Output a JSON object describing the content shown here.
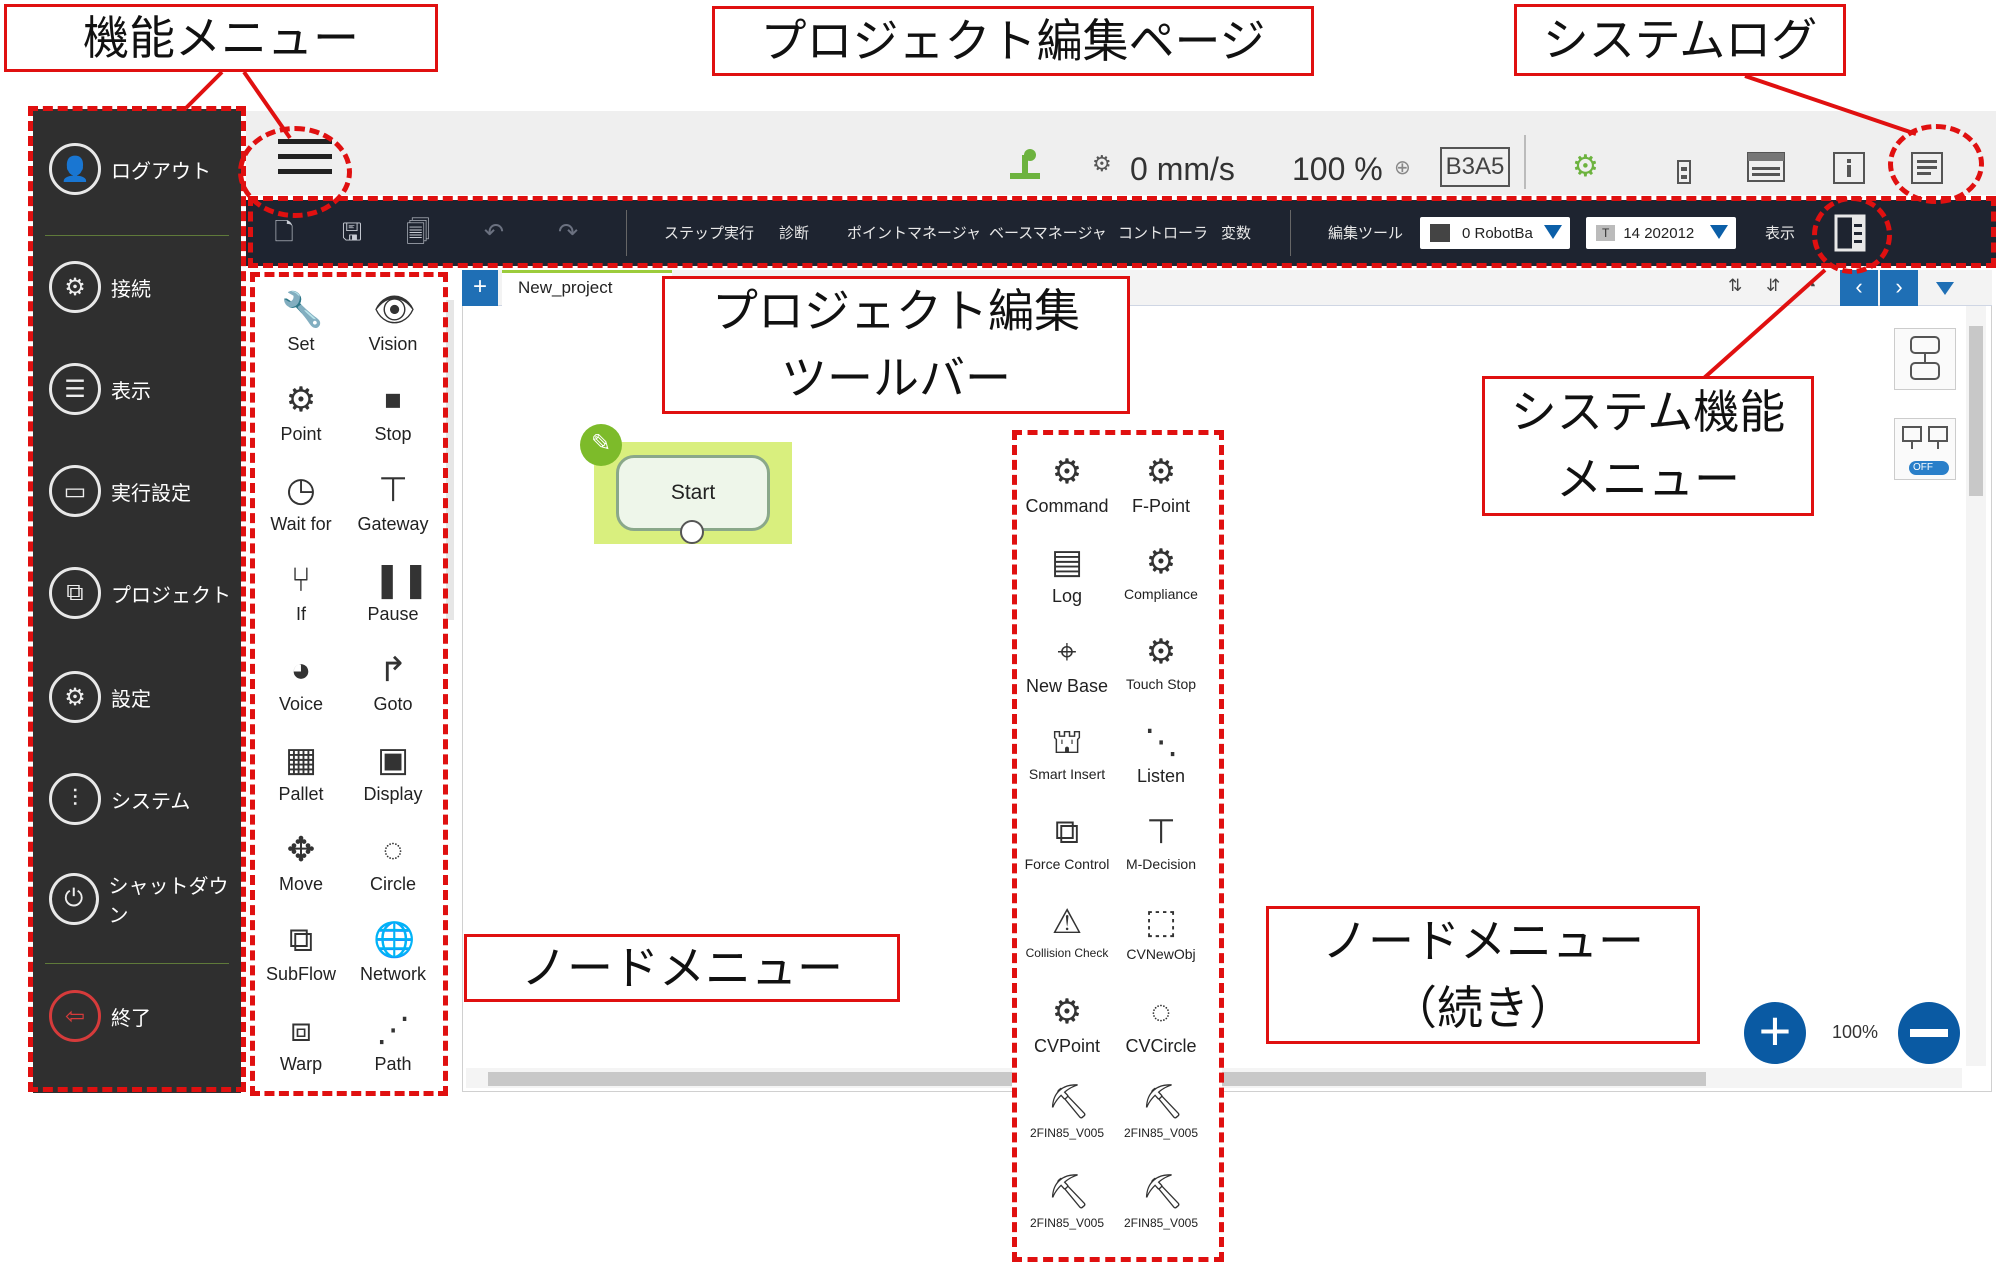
{
  "callouts": {
    "function_menu": "機能メニュー",
    "project_edit_page": "プロジェクト編集ページ",
    "system_log": "システムログ",
    "project_edit_toolbar": "プロジェクト編集\nツールバー",
    "system_function_menu": "システム機能\nメニュー",
    "node_menu": "ノードメニュー",
    "node_menu_continued": "ノードメニュー\n（続き）"
  },
  "function_menu": {
    "items": [
      {
        "label": "ログアウト",
        "icon": "user-icon"
      },
      {
        "label": "接続",
        "icon": "connection-icon"
      },
      {
        "label": "表示",
        "icon": "display-icon"
      },
      {
        "label": "実行設定",
        "icon": "run-settings-icon"
      },
      {
        "label": "プロジェクト",
        "icon": "project-icon"
      },
      {
        "label": "設定",
        "icon": "gear-icon"
      },
      {
        "label": "システム",
        "icon": "sliders-icon"
      },
      {
        "label": "シャットダウン",
        "icon": "power-icon"
      },
      {
        "label": "終了",
        "icon": "exit-icon"
      }
    ]
  },
  "header": {
    "speed": "0 mm/s",
    "speed_percent": "100 %",
    "robot_id": "B3A5"
  },
  "toolbar": {
    "menu_items": [
      "ステップ実行",
      "診断",
      "ポイントマネージャ",
      "ベースマネージャ",
      "コントローラ",
      "変数"
    ],
    "edit_tools": "編集ツール",
    "robot_select": "0 RobotBa",
    "tool_select": "14 202012",
    "tool_select_tag": "T",
    "view_label": "表示"
  },
  "palette": {
    "left_column": [
      "Set",
      "Point",
      "Wait for",
      "If",
      "Voice",
      "Pallet",
      "Move",
      "SubFlow",
      "Warp"
    ],
    "right_column": [
      "Vision",
      "Stop",
      "Gateway",
      "Pause",
      "Goto",
      "Display",
      "Circle",
      "Network",
      "Path"
    ]
  },
  "palette_continued": {
    "left_column": [
      "Command",
      "Log",
      "New Base",
      "Smart Insert",
      "Force Control",
      "Collision Check",
      "CVPoint",
      "2FIN85_V005",
      "2FIN85_V005"
    ],
    "right_column": [
      "F-Point",
      "Compliance",
      "Touch Stop",
      "Listen",
      "M-Decision",
      "CVNewObj",
      "CVCircle",
      "2FIN85_V005",
      "2FIN85_V005"
    ]
  },
  "canvas": {
    "tab_add": "+",
    "tab_name": "New_project",
    "start_node": "Start",
    "zoom": "100%",
    "toggle": "OFF"
  },
  "colors": {
    "accent_red": "#e01010",
    "sidebar_bg": "#2f2f2f",
    "toolbar_bg": "#1e2430",
    "nav_blue": "#0b5fa8",
    "start_highlight": "#d9ef7e"
  }
}
